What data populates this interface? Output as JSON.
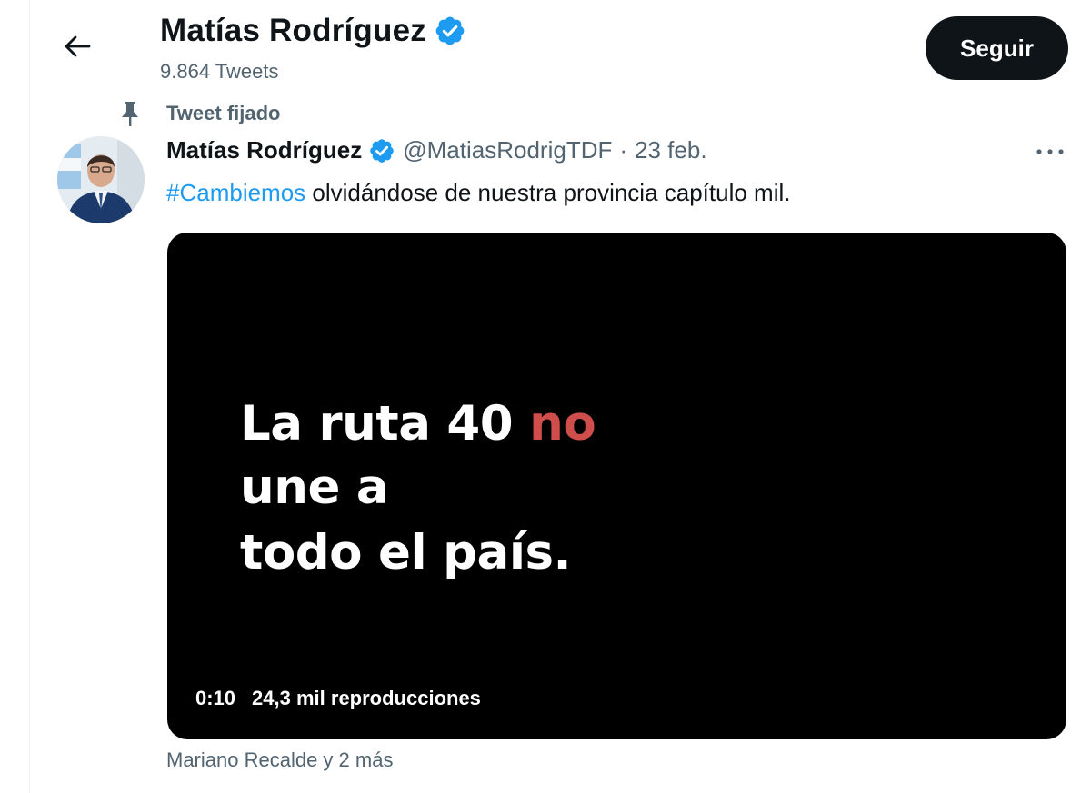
{
  "header": {
    "name": "Matías Rodríguez",
    "tweet_count": "9.864 Tweets",
    "follow_label": "Seguir"
  },
  "pinned": {
    "label": "Tweet fijado"
  },
  "tweet": {
    "author_name": "Matías Rodríguez",
    "handle": "@MatiasRodrigTDF",
    "separator": "·",
    "date": "23 feb.",
    "hashtag": "#Cambiemos",
    "text": "olvidándose de nuestra provincia capítulo mil."
  },
  "media": {
    "line1_a": "La ruta 40 ",
    "line1_b": "no",
    "line2": "une a",
    "line3": "todo el país.",
    "duration": "0:10",
    "views": "24,3 mil reproducciones"
  },
  "social_context": "Mariano Recalde y 2 más",
  "colors": {
    "verified": "#1d9bf0",
    "link": "#1d9bf0",
    "muted": "#536471",
    "video_highlight": "#cf4d4a"
  },
  "icons": {
    "back": "arrow-left-icon",
    "verified": "verified-badge-icon",
    "pin": "pin-icon",
    "more": "more-horizontal-icon"
  }
}
